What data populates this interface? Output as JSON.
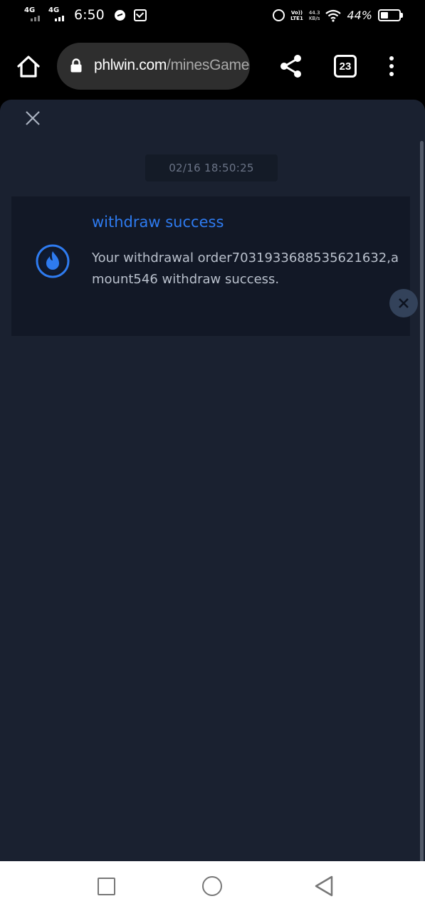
{
  "status_bar": {
    "network1": "4G",
    "network2": "4G",
    "time": "6:50",
    "volte": [
      "Vo))",
      "LTE1"
    ],
    "speed": [
      "44.3",
      "KB/s"
    ],
    "battery_percent": "44%"
  },
  "browser": {
    "url_domain": "phlwin.com",
    "url_path": "/minesGame",
    "tab_count": "23"
  },
  "message": {
    "timestamp": "02/16 18:50:25",
    "title": "withdraw success",
    "body": "Your withdrawal order7031933688535621632,amount546 withdraw success.",
    "accent_color": "#2e7bf0"
  },
  "icons": {
    "home": "home-icon",
    "lock": "lock-icon",
    "share": "share-icon",
    "menu": "more-vert-icon",
    "close": "close-icon",
    "message": "flame-icon",
    "nav_recent": "square-icon",
    "nav_home": "circle-icon",
    "nav_back": "triangle-back-icon"
  }
}
